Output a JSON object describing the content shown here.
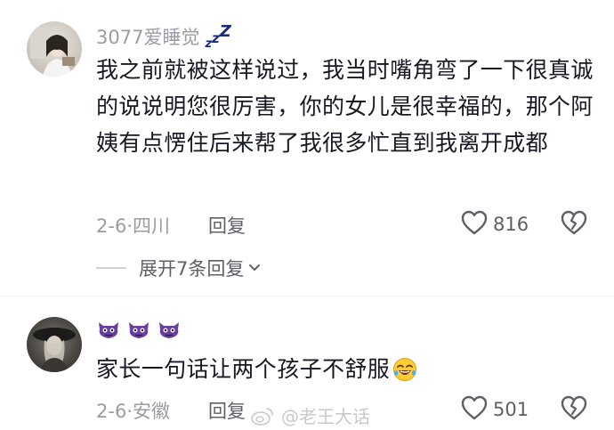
{
  "comments": [
    {
      "username": "3077爱睡觉",
      "zzz": [
        "z",
        "z",
        "Z"
      ],
      "text": "我之前就被这样说过，我当时嘴角弯了一下很真诚的说说明您很厉害，你的女儿是很幸福的，那个阿姨有点愣住后来帮了我很多忙直到我离开成都",
      "date": "2-6",
      "separator": "·",
      "location": "四川",
      "reply_label": "回复",
      "likes": "816",
      "expand_label": "展开7条回复"
    },
    {
      "emote_icons": [
        "purple-devil-emoji",
        "purple-devil-emoji",
        "purple-devil-emoji"
      ],
      "text": "家长一句话让两个孩子不舒服",
      "emoji": "rolling-on-floor-laughing-emoji",
      "date": "2-6",
      "separator": "·",
      "location": "安徽",
      "reply_label": "回复",
      "likes": "501"
    }
  ],
  "watermark": {
    "prefix": "微博",
    "handle": "@老王大话"
  },
  "colors": {
    "primary_text": "#161823",
    "secondary_text": "#9a9ca3",
    "action_text": "#5e6068",
    "devil_purple": "#6b3fa0"
  }
}
